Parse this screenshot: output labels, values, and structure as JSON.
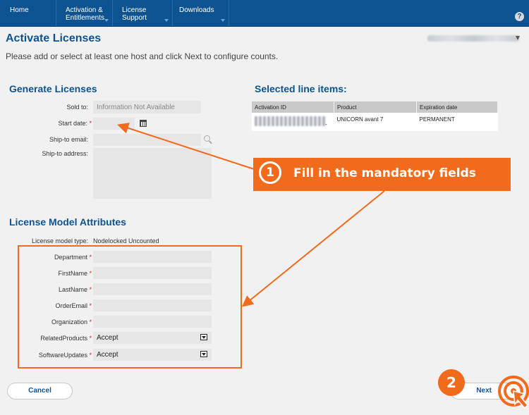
{
  "nav": {
    "items": [
      {
        "label": "Home",
        "has_menu": false
      },
      {
        "label": "Activation & Entitlements",
        "has_menu": true
      },
      {
        "label": "License Support",
        "has_menu": true
      },
      {
        "label": "Downloads",
        "has_menu": true
      }
    ],
    "help_glyph": "?"
  },
  "page": {
    "title": "Activate Licenses",
    "instruction": "Please add or select at least one host and click Next to configure counts."
  },
  "generate": {
    "title": "Generate Licenses",
    "sold_to_label": "Sold to:",
    "sold_to_value": "Information Not Available",
    "start_date_label": "Start date:",
    "ship_email_label": "Ship-to email:",
    "ship_address_label": "Ship-to address:",
    "required_mark": "*"
  },
  "selected": {
    "title": "Selected line items:",
    "columns": [
      "Activation ID",
      "Product",
      "Expiration date"
    ],
    "rows": [
      {
        "activation_id": "-",
        "product": "UNICORN avant 7",
        "expiration": "PERMANENT"
      }
    ]
  },
  "attributes": {
    "title": "License Model Attributes",
    "model_type_label": "License model type:",
    "model_type_value": "Nodelocked Uncounted",
    "department_label": "Department",
    "firstname_label": "FirstName",
    "lastname_label": "LastName",
    "orderemail_label": "OrderEmail",
    "organization_label": "Organization",
    "relatedproducts_label": "RelatedProducts",
    "relatedproducts_value": "Accept",
    "softwareupdates_label": "SoftwareUpdates",
    "softwareupdates_value": "Accept"
  },
  "callout": {
    "number": "1",
    "text": "Fill in the mandatory fields",
    "color": "#f26a1b"
  },
  "step2": {
    "number": "2"
  },
  "buttons": {
    "cancel": "Cancel",
    "next": "Next"
  },
  "colors": {
    "nav_bg": "#0d5391",
    "heading": "#0d5391",
    "accent": "#f26a1b",
    "required": "#d9232e"
  }
}
